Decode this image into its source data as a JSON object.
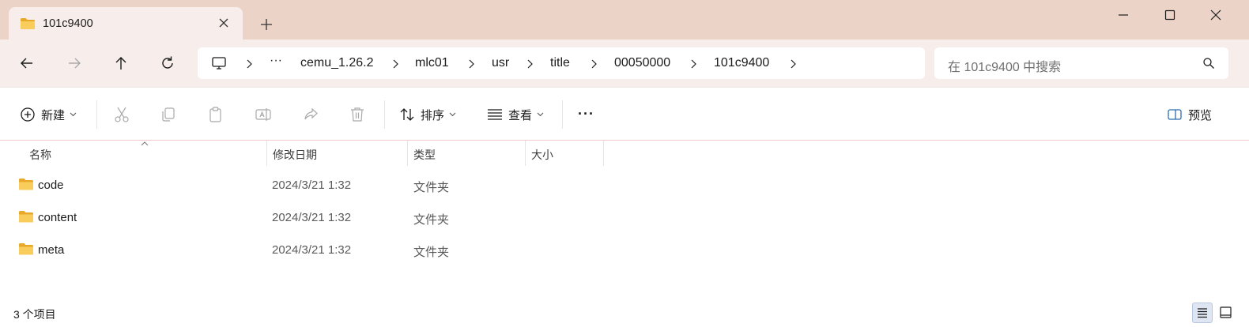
{
  "tab": {
    "title": "101c9400",
    "icon": "folder-icon"
  },
  "window": {
    "controls": [
      "minimize-icon",
      "maximize-icon",
      "close-icon"
    ]
  },
  "breadcrumb": {
    "overflow": "···",
    "items": [
      "cemu_1.26.2",
      "mlc01",
      "usr",
      "title",
      "00050000",
      "101c9400"
    ]
  },
  "search": {
    "placeholder": "在 101c9400 中搜索"
  },
  "toolbar": {
    "new_label": "新建",
    "sort_label": "排序",
    "view_label": "查看",
    "more_label": "···",
    "preview_label": "预览"
  },
  "columns": {
    "name": "名称",
    "modified": "修改日期",
    "type": "类型",
    "size": "大小"
  },
  "files": [
    {
      "name": "code",
      "modified": "2024/3/21 1:32",
      "type": "文件夹",
      "size": ""
    },
    {
      "name": "content",
      "modified": "2024/3/21 1:32",
      "type": "文件夹",
      "size": ""
    },
    {
      "name": "meta",
      "modified": "2024/3/21 1:32",
      "type": "文件夹",
      "size": ""
    }
  ],
  "status": {
    "item_count": "3 个项目"
  },
  "colors": {
    "titlebar": "#ebd3c7",
    "navbar": "#f7eeeb",
    "folder": "#f5c451",
    "accent": "#2b6cb0"
  }
}
